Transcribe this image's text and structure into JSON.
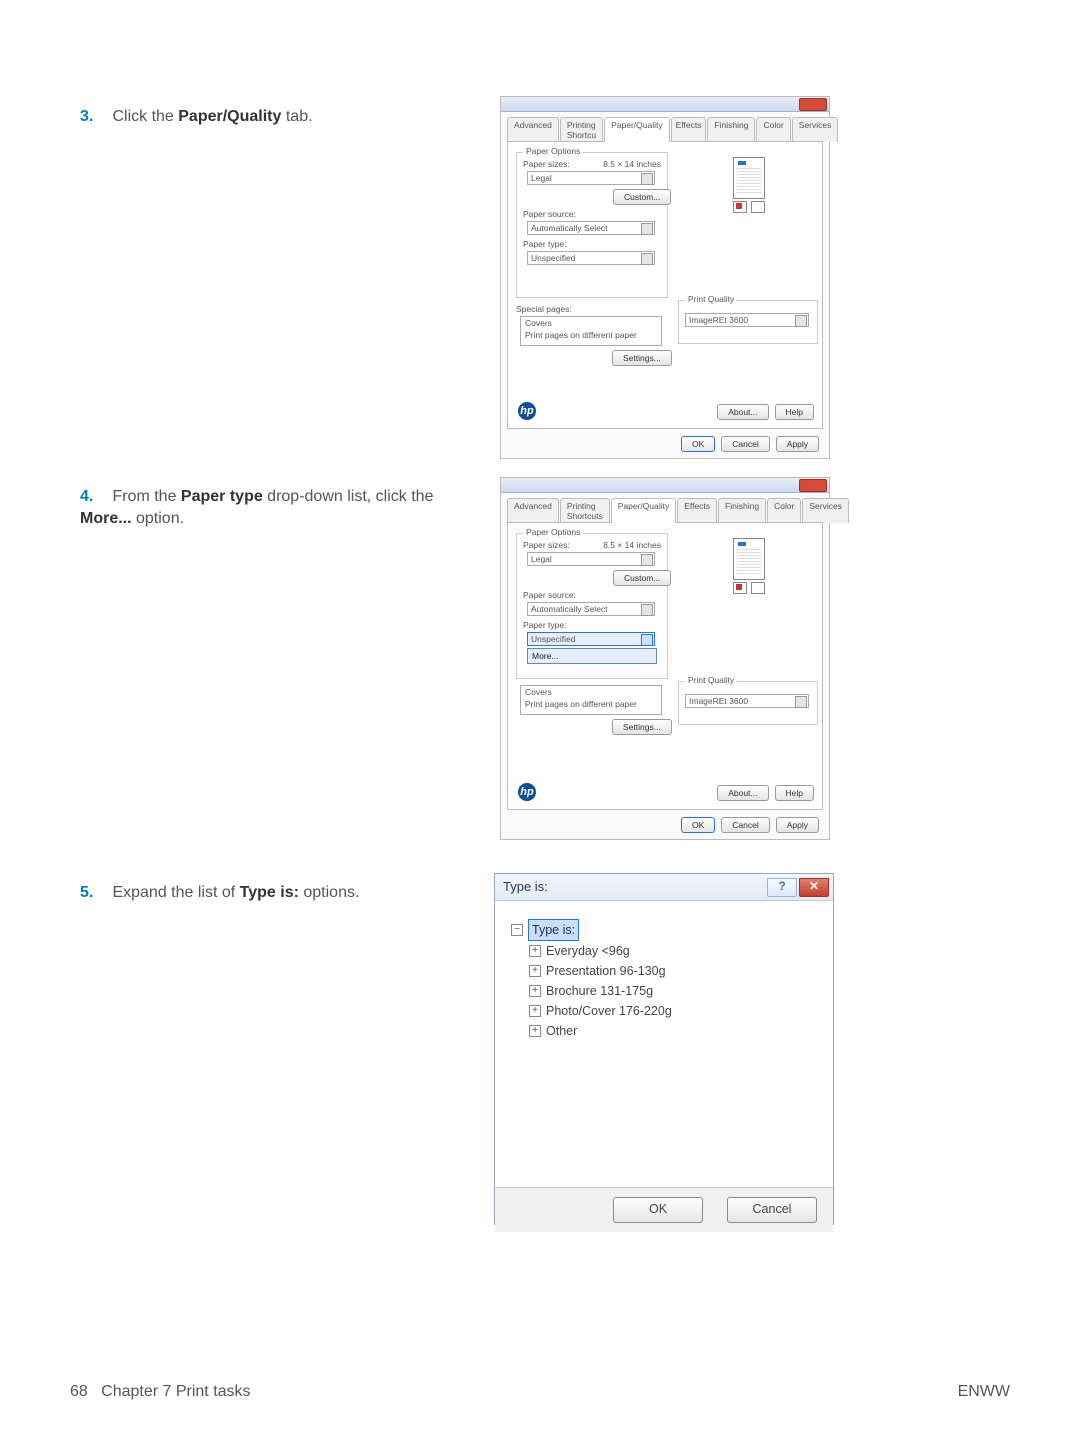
{
  "steps": {
    "s3": {
      "num": "3.",
      "pre": "Click the ",
      "bold": "Paper/Quality",
      "post": " tab."
    },
    "s4": {
      "num": "4.",
      "pre": "From the ",
      "bold1": "Paper type",
      "mid": " drop-down list, click the ",
      "bold2": "More...",
      "post": " option."
    },
    "s5": {
      "num": "5.",
      "pre": "Expand the list of ",
      "bold": "Type is:",
      "post": " options."
    }
  },
  "dialog": {
    "tabs": {
      "advanced": "Advanced",
      "shortcuts": "Printing Shortcuts",
      "paperquality": "Paper/Quality",
      "effects": "Effects",
      "finishing": "Finishing",
      "color": "Color",
      "services": "Services",
      "shortcuts_short": "Printing Shortcu"
    },
    "paper_options_legend": "Paper Options",
    "paper_sizes_label": "Paper sizes:",
    "paper_sizes_dim": "8.5 × 14 inches",
    "paper_size_value": "Legal",
    "custom_btn": "Custom...",
    "paper_source_label": "Paper source:",
    "paper_source_value": "Automatically Select",
    "paper_type_label": "Paper type:",
    "paper_type_value": "Unspecified",
    "more_option": "More...",
    "special_pages_legend": "Special pages:",
    "covers": "Covers",
    "ppodp": "Print pages on different paper",
    "settings_btn": "Settings...",
    "print_quality_legend": "Print Quality",
    "print_quality_value": "ImageREt 3600",
    "about_btn": "About...",
    "help_btn": "Help",
    "ok_btn": "OK",
    "cancel_btn": "Cancel",
    "apply_btn": "Apply"
  },
  "typeis": {
    "title": "Type is:",
    "root": "Type is:",
    "nodes": {
      "n1": "Everyday <96g",
      "n2": "Presentation 96-130g",
      "n3": "Brochure 131-175g",
      "n4": "Photo/Cover 176-220g",
      "n5": "Other"
    },
    "ok": "OK",
    "cancel": "Cancel",
    "help_glyph": "?",
    "close_glyph": "✕"
  },
  "footer": {
    "page": "68",
    "chapter": "Chapter 7   Print tasks",
    "right": "ENWW"
  }
}
